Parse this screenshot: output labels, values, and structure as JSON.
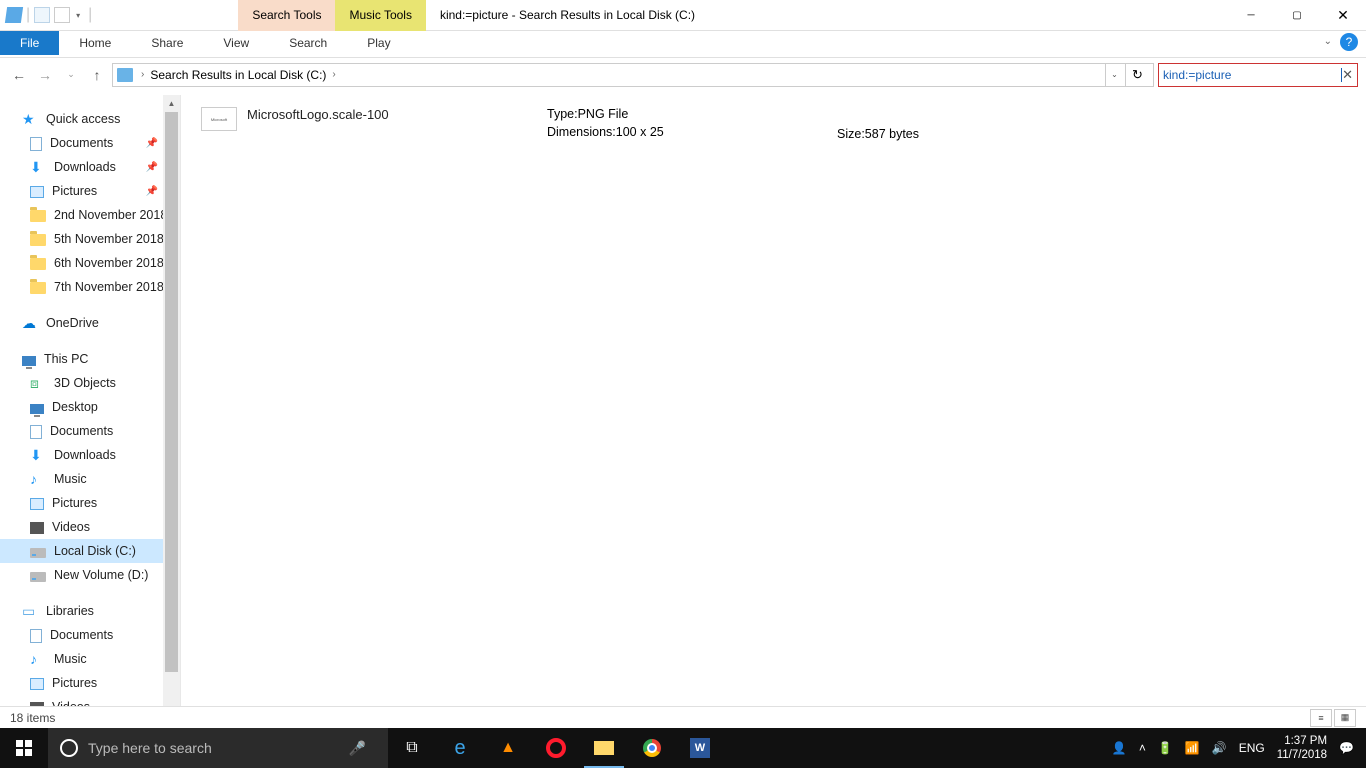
{
  "window": {
    "title": "kind:=picture - Search Results in Local Disk (C:)",
    "search_tools_label": "Search Tools",
    "music_tools_label": "Music Tools"
  },
  "ribbon": {
    "file": "File",
    "tabs": [
      "Home",
      "Share",
      "View",
      "Search",
      "Play"
    ]
  },
  "address": {
    "path": "Search Results in Local Disk (C:)",
    "search_text": "kind:=picture"
  },
  "nav": {
    "quick_access": "Quick access",
    "pinned": [
      {
        "label": "Documents",
        "icon": "doc"
      },
      {
        "label": "Downloads",
        "icon": "dl"
      },
      {
        "label": "Pictures",
        "icon": "pic"
      }
    ],
    "recent": [
      "2nd November 2018",
      "5th November 2018",
      "6th November 2018",
      "7th November 2018"
    ],
    "onedrive": "OneDrive",
    "this_pc": "This PC",
    "pc_items": [
      {
        "label": "3D Objects",
        "icon": "cube"
      },
      {
        "label": "Desktop",
        "icon": "monitor"
      },
      {
        "label": "Documents",
        "icon": "doc"
      },
      {
        "label": "Downloads",
        "icon": "dl"
      },
      {
        "label": "Music",
        "icon": "music"
      },
      {
        "label": "Pictures",
        "icon": "pic"
      },
      {
        "label": "Videos",
        "icon": "vid"
      },
      {
        "label": "Local Disk (C:)",
        "icon": "disk",
        "selected": true
      },
      {
        "label": "New Volume (D:)",
        "icon": "disk"
      }
    ],
    "libraries": "Libraries",
    "lib_items": [
      {
        "label": "Documents",
        "icon": "doc"
      },
      {
        "label": "Music",
        "icon": "music"
      },
      {
        "label": "Pictures",
        "icon": "pic"
      },
      {
        "label": "Videos",
        "icon": "vid"
      }
    ]
  },
  "result": {
    "name": "MicrosoftLogo.scale-100",
    "type_label": "Type:",
    "type_val": "PNG File",
    "dim_label": "Dimensions:",
    "dim_val": "100 x 25",
    "size_label": "Size:",
    "size_val": "587 bytes"
  },
  "status": {
    "items": "18 items"
  },
  "taskbar": {
    "search_placeholder": "Type here to search",
    "lang": "ENG",
    "time": "1:37 PM",
    "date": "11/7/2018"
  }
}
